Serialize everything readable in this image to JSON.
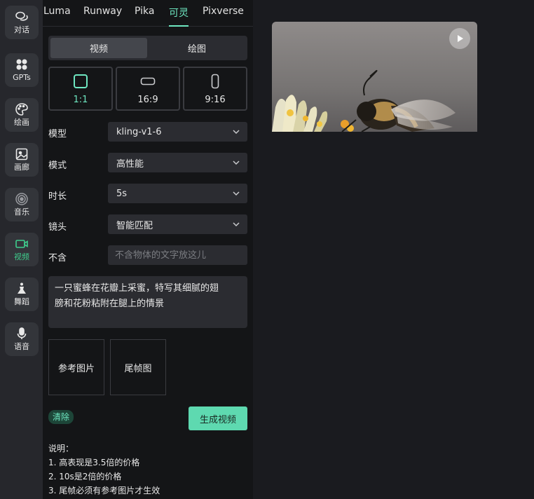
{
  "sidebar": {
    "items": [
      {
        "label": "对话",
        "icon": "chat-icon"
      },
      {
        "label": "GPTs",
        "icon": "grid-icon"
      },
      {
        "label": "绘画",
        "icon": "palette-icon"
      },
      {
        "label": "画廊",
        "icon": "image-icon"
      },
      {
        "label": "音乐",
        "icon": "music-disc-icon"
      },
      {
        "label": "视频",
        "icon": "video-icon",
        "active": true
      },
      {
        "label": "舞蹈",
        "icon": "dance-icon"
      },
      {
        "label": "语音",
        "icon": "microphone-icon"
      }
    ]
  },
  "tabs": [
    {
      "label": "Luma"
    },
    {
      "label": "Runway"
    },
    {
      "label": "Pika"
    },
    {
      "label": "可灵",
      "active": true
    },
    {
      "label": "Pixverse"
    }
  ],
  "mode_toggle": {
    "video": "视频",
    "image": "绘图",
    "active": "视频"
  },
  "ratios": [
    {
      "label": "1:1",
      "active": true
    },
    {
      "label": "16:9"
    },
    {
      "label": "9:16"
    }
  ],
  "form": {
    "model": {
      "label": "模型",
      "value": "kling-v1-6"
    },
    "mode": {
      "label": "模式",
      "value": "高性能"
    },
    "duration": {
      "label": "时长",
      "value": "5s"
    },
    "camera": {
      "label": "镜头",
      "value": "智能匹配"
    },
    "negative": {
      "label": "不含",
      "placeholder": "不含物体的文字放这儿",
      "value": ""
    }
  },
  "prompt": {
    "line1": "一只蜜蜂在花瓣上采蜜，特写其细腻的翅",
    "line2": "膀和花粉粘附在腿上的情景"
  },
  "uploads": {
    "reference": "参考图片",
    "tail": "尾帧图"
  },
  "actions": {
    "clear": "清除",
    "generate": "生成视频"
  },
  "notes": {
    "title": "说明：",
    "items": [
      "1. 高表现是3.5倍的价格",
      "2. 10s是2倍的价格",
      "3. 尾帧必须有参考图片才生效"
    ]
  },
  "colors": {
    "accent": "#6ee7c1",
    "button": "#5ed9b0",
    "active_sidebar": "#3fce8d",
    "panel_bg": "#141517",
    "page_bg": "#1a1b1f"
  }
}
